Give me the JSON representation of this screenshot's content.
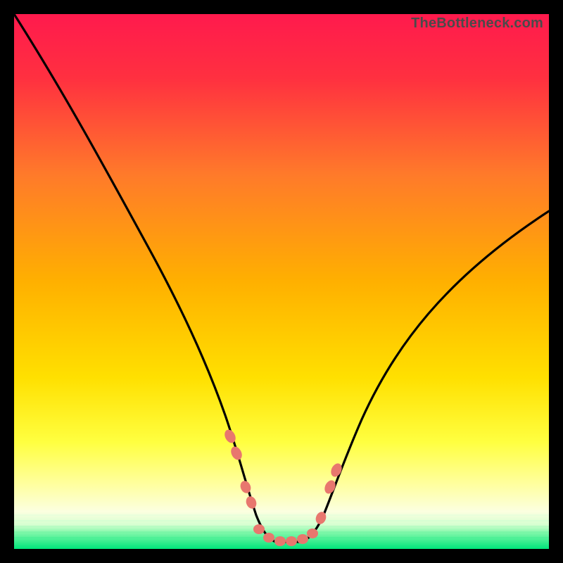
{
  "watermark": "TheBottleneck.com",
  "colors": {
    "frame": "#000000",
    "curve": "#000000",
    "dots": "#e8776e",
    "green_band": "#00e57a",
    "gradient_top": "#ff1a4d",
    "gradient_mid1": "#ff6a2a",
    "gradient_mid2": "#ffd000",
    "gradient_low": "#ffff66",
    "gradient_pale": "#fdffd6"
  },
  "chart_data": {
    "type": "line",
    "title": "",
    "xlabel": "",
    "ylabel": "",
    "xlim": [
      0,
      100
    ],
    "ylim": [
      0,
      100
    ],
    "x": [
      0,
      5,
      10,
      15,
      20,
      25,
      30,
      35,
      38,
      40,
      42,
      44,
      46,
      48,
      50,
      52,
      54,
      56,
      58,
      60,
      65,
      70,
      75,
      80,
      85,
      90,
      95,
      100
    ],
    "y": [
      100,
      91,
      81,
      71,
      61,
      51,
      41,
      30,
      22,
      16,
      10,
      6,
      3,
      1.5,
      1,
      1,
      1.5,
      3,
      6,
      10,
      20,
      29,
      37,
      44,
      50,
      55,
      59,
      63
    ],
    "annotations": {
      "flat_bottom_range_x": [
        44,
        56
      ],
      "flat_bottom_y": 1,
      "dot_positions_x": [
        40,
        41.5,
        42.5,
        44,
        46,
        48,
        50,
        52,
        54,
        56,
        57.5,
        59,
        60
      ],
      "dot_positions_y": [
        16,
        12,
        9,
        4.5,
        2.5,
        1.6,
        1.3,
        1.3,
        1.7,
        3,
        5,
        8,
        11
      ]
    }
  }
}
